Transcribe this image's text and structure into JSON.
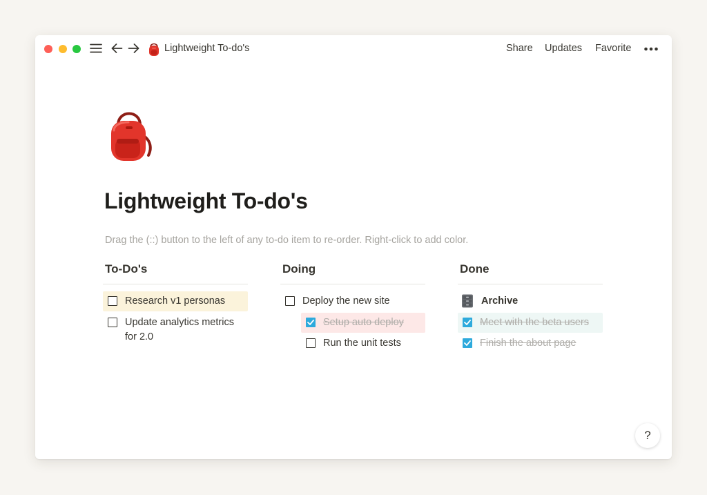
{
  "window": {
    "title": "Lightweight To-do's",
    "page_icon": "backpack-icon",
    "actions": {
      "share": "Share",
      "updates": "Updates",
      "favorite": "Favorite"
    },
    "icons": [
      "menu-icon",
      "back-arrow-icon",
      "forward-arrow-icon",
      "more-icon"
    ]
  },
  "page": {
    "emoji": "backpack-icon",
    "title": "Lightweight To-do's",
    "hint": "Drag the (::) button to the left of any to-do item to re-order. Right-click to add color."
  },
  "board": {
    "columns": [
      {
        "title": "To-Do's",
        "items": [
          {
            "label": "Research v1 personas",
            "checked": false,
            "background": "#fbf3db"
          },
          {
            "label": "Update analytics metrics for 2.0",
            "checked": false
          }
        ]
      },
      {
        "title": "Doing",
        "items": [
          {
            "label": "Deploy the new site",
            "checked": false
          },
          {
            "label": "Setup auto deploy",
            "checked": true,
            "background": "#fde8e7",
            "indent": 1
          },
          {
            "label": "Run the unit tests",
            "checked": false,
            "indent": 1
          }
        ]
      },
      {
        "title": "Done",
        "items": [
          {
            "label": "Archive",
            "type": "page",
            "icon": "file-cabinet-icon"
          },
          {
            "label": "Meet with the beta users",
            "checked": true,
            "background": "#eef7f5"
          },
          {
            "label": "Finish the about page",
            "checked": true
          }
        ]
      }
    ]
  },
  "help": {
    "label": "?"
  },
  "colors": {
    "accent_checkbox": "#2eaadc",
    "text": "#37352f",
    "hint": "#a6a49f"
  }
}
